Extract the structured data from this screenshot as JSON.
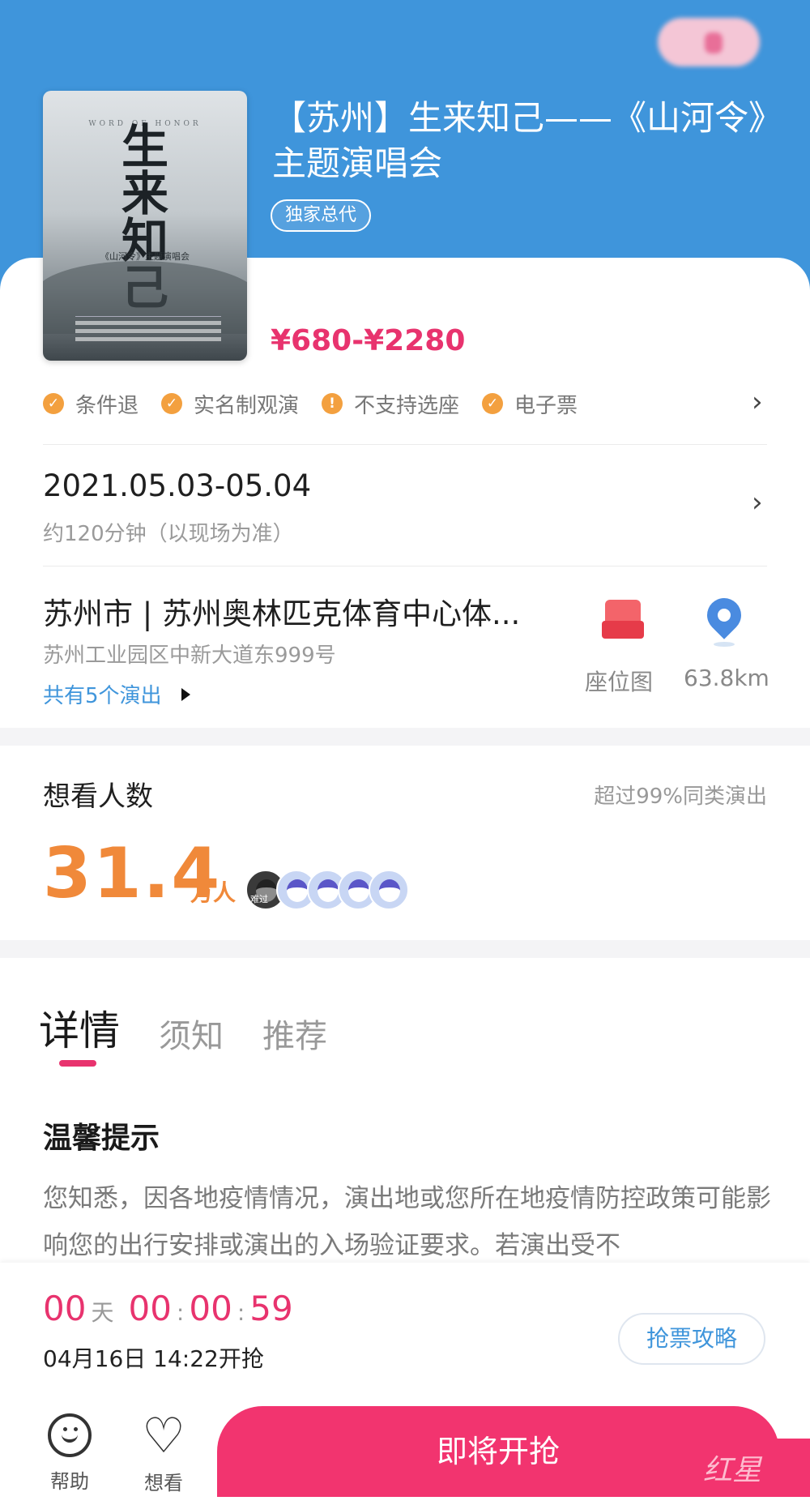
{
  "event": {
    "title": "【苏州】生来知己——《山河令》主题演唱会",
    "badge": "独家总代",
    "price": "¥680-¥2280",
    "poster": {
      "word_text": "WORD OF HONOR",
      "title_text": "生来知己",
      "subtitle_text": "《山河令》主题演唱会"
    }
  },
  "features": [
    {
      "icon": "check-icon",
      "label": "条件退"
    },
    {
      "icon": "check-icon",
      "label": "实名制观演"
    },
    {
      "icon": "exclamation-icon",
      "label": "不支持选座"
    },
    {
      "icon": "check-icon",
      "label": "电子票"
    }
  ],
  "schedule": {
    "date": "2021.05.03-05.04",
    "duration": "约120分钟（以现场为准）"
  },
  "venue": {
    "name": "苏州市 | 苏州奥林匹克体育中心体...",
    "address": "苏州工业园区中新大道东999号",
    "shows_link": "共有5个演出",
    "seat_map_label": "座位图",
    "distance": "63.8km"
  },
  "interest": {
    "title": "想看人数",
    "note": "超过99%同类演出",
    "count": "31.4",
    "unit": "万人",
    "avatar_tag": "难过"
  },
  "tabs": [
    {
      "label": "详情",
      "active": true
    },
    {
      "label": "须知",
      "active": false
    },
    {
      "label": "推荐",
      "active": false
    }
  ],
  "notice": {
    "title": "温馨提示",
    "text": "您知悉，因各地疫情情况，演出地或您所在地疫情防控政策可能影响您的出行安排或演出的入场验证要求。若演出受不"
  },
  "countdown": {
    "days": "00",
    "days_unit": "天",
    "hours": "00",
    "minutes": "00",
    "seconds": "59",
    "open_time": "04月16日 14:22开抢",
    "guide_button": "抢票攻略"
  },
  "bottom": {
    "help_label": "帮助",
    "want_label": "想看",
    "grab_button": "即将开抢",
    "watermark": "红星"
  },
  "colors": {
    "header_blue": "#3f95db",
    "accent_pink": "#e8336e",
    "count_orange": "#f0893a",
    "feature_orange": "#f3a03f"
  }
}
